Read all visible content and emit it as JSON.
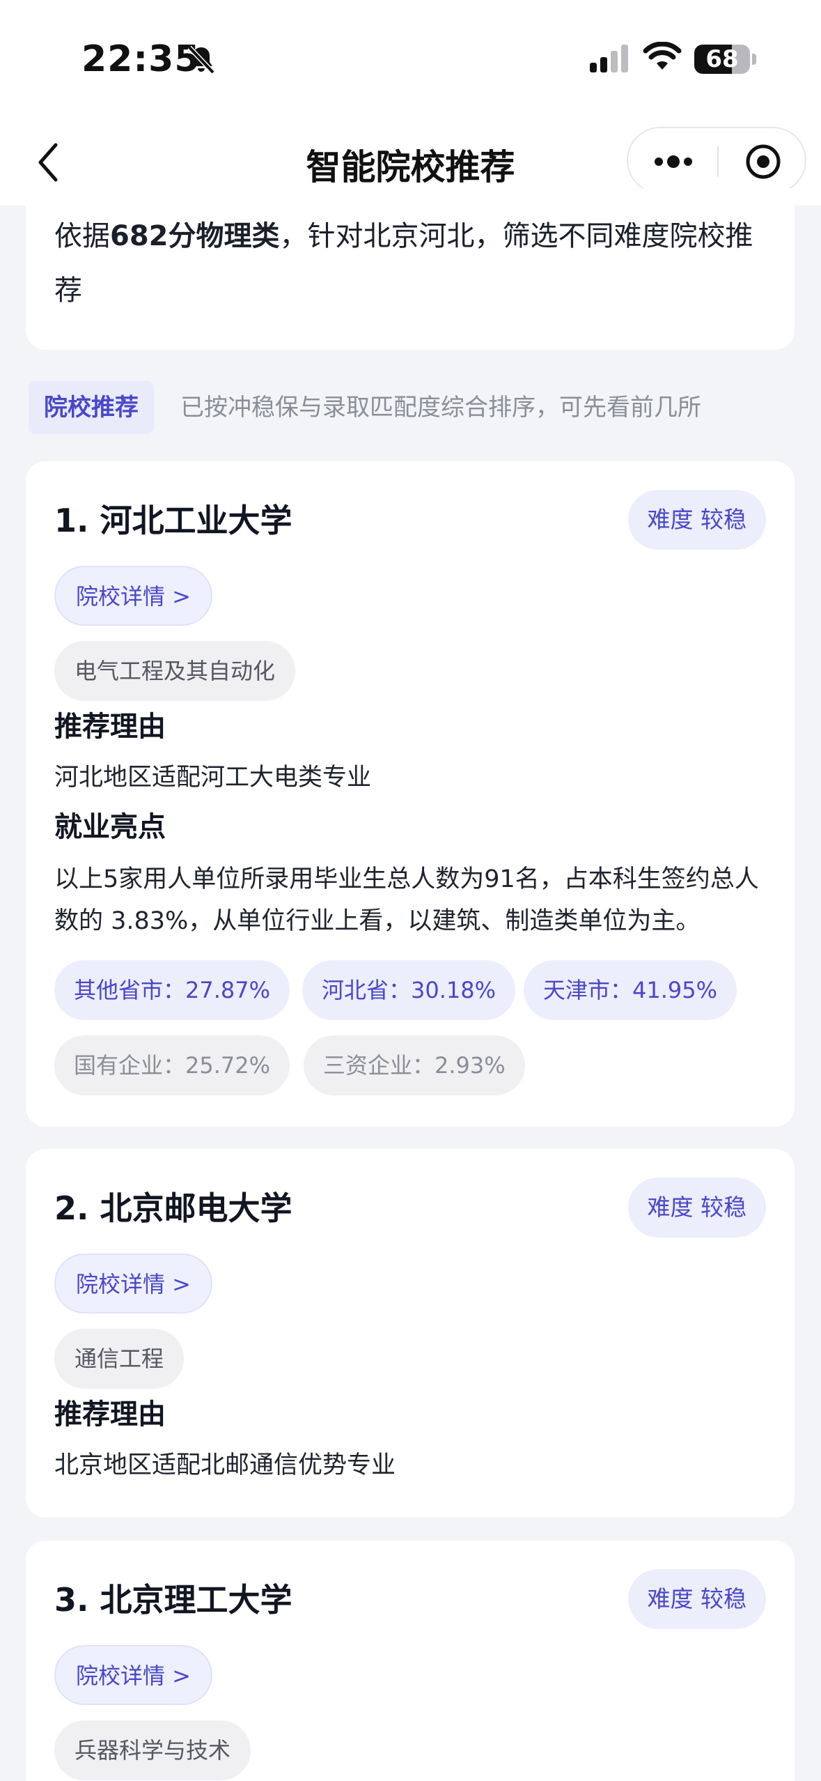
{
  "status_bar": {
    "time": "22:35",
    "battery": "68",
    "battery_level": 0.68
  },
  "nav": {
    "title": "智能院校推荐"
  },
  "intro": {
    "text_before": "依据",
    "highlight": "682分物理类",
    "text_after": "，针对北京河北，筛选不同难度院校推荐"
  },
  "section": {
    "tag": "院校推荐",
    "desc": "已按冲稳保与录取匹配度综合排序，可先看前几所"
  },
  "schools": [
    {
      "title": "1. 河北工业大学",
      "difficulty": "难度 较稳",
      "detail_label": "院校详情 >",
      "major": "电气工程及其自动化",
      "reason_heading": "推荐理由",
      "reason": "河北地区适配河工大电类专业",
      "employment_heading": "就业亮点",
      "employment_text": "以上5家用人单位所录用毕业生总人数为91名，占本科生签约总人数的 3.83%，从单位行业上看，以建筑、制造类单位为主。",
      "stats_region": [
        "其他省市：27.87%",
        "河北省：30.18%",
        "天津市：41.95%"
      ],
      "stats_type": [
        "国有企业：25.72%",
        "三资企业：2.93%"
      ]
    },
    {
      "title": "2. 北京邮电大学",
      "difficulty": "难度 较稳",
      "detail_label": "院校详情 >",
      "major": "通信工程",
      "reason_heading": "推荐理由",
      "reason": "北京地区适配北邮通信优势专业"
    },
    {
      "title": "3. 北京理工大学",
      "difficulty": "难度 较稳",
      "detail_label": "院校详情 >",
      "major": "兵器科学与技术"
    }
  ]
}
